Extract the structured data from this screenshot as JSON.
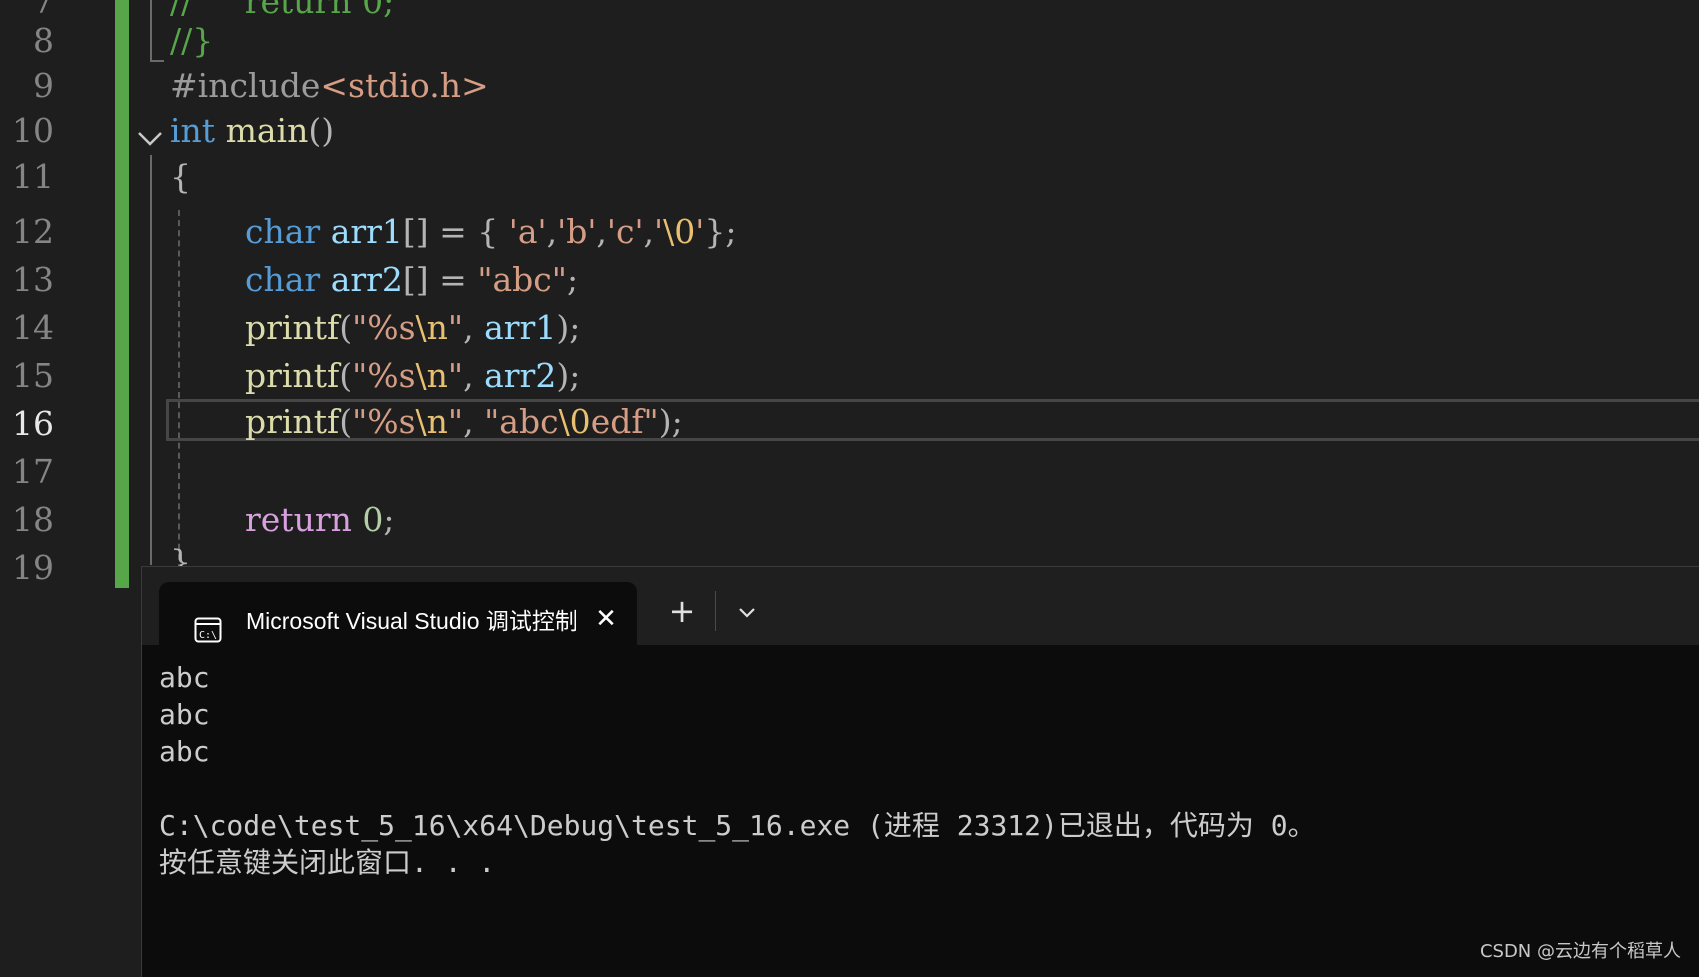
{
  "editor": {
    "line_numbers": [
      "8",
      "9",
      "10",
      "11",
      "12",
      "13",
      "14",
      "15",
      "16",
      "17",
      "18",
      "19"
    ],
    "current_line": "16",
    "lines": {
      "top_partial": [
        "//",
        "return",
        "0",
        ";"
      ],
      "l8": [
        "//}"
      ],
      "l9": [
        "#include",
        "<stdio.h>"
      ],
      "l10": [
        "int",
        " ",
        "main",
        "()"
      ],
      "l11": [
        "{"
      ],
      "l12": [
        "char",
        " ",
        "arr1",
        "[] = { ",
        "'a'",
        ",",
        "'b'",
        ",",
        "'c'",
        ",",
        "'",
        "\\0",
        "'",
        "};"
      ],
      "l13": [
        "char",
        " ",
        "arr2",
        "[] = ",
        "\"abc\"",
        ";"
      ],
      "l14": [
        "printf",
        "(",
        "\"%s",
        "\\n",
        "\"",
        ", ",
        "arr1",
        ");"
      ],
      "l15": [
        "printf",
        "(",
        "\"%s",
        "\\n",
        "\"",
        ", ",
        "arr2",
        ");"
      ],
      "l16": [
        "printf",
        "(",
        "\"%s",
        "\\n",
        "\"",
        ", ",
        "\"abc",
        "\\0",
        "edf\"",
        ");"
      ],
      "l18": [
        "return",
        " ",
        "0",
        ";"
      ],
      "l19": [
        "}"
      ]
    }
  },
  "terminal": {
    "tab_title": "Microsoft Visual Studio 调试控制台",
    "tab_icon": "console-icon",
    "close_label": "✕",
    "add_label": "+",
    "output_lines": [
      "abc",
      "abc",
      "abc",
      "",
      "C:\\code\\test_5_16\\x64\\Debug\\test_5_16.exe (进程 23312)已退出，代码为 0。",
      "按任意键关闭此窗口. . ."
    ]
  },
  "watermark": "CSDN @云边有个稻草人",
  "colors": {
    "background": "#1e1e1e",
    "keyword": "#569cd6",
    "function": "#dcdcaa",
    "string": "#d69d85",
    "changebar": "#57a64a"
  }
}
